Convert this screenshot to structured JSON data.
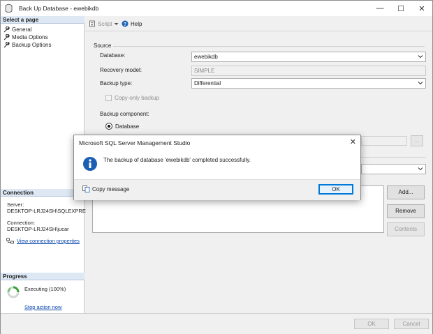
{
  "window": {
    "title": "Back Up Database - ewebikdb",
    "controls": {
      "minimize": "—",
      "maximize": "☐",
      "close": "✕"
    }
  },
  "left_panel": {
    "select_page_header": "Select a page",
    "pages": [
      {
        "label": "General"
      },
      {
        "label": "Media Options"
      },
      {
        "label": "Backup Options"
      }
    ],
    "connection_header": "Connection",
    "server_label": "Server:",
    "server_value": "DESKTOP-LRJ24SH\\SQLEXPRE",
    "connection_label": "Connection:",
    "connection_value": "DESKTOP-LRJ24SH\\jucar",
    "view_connection_link": "View connection properties",
    "progress_header": "Progress",
    "progress_status": "Executing (100%)",
    "stop_action_link": "Stop action now"
  },
  "toolbar": {
    "script_label": "Script",
    "help_label": "Help"
  },
  "form": {
    "source_group": "Source",
    "database_label": "Database:",
    "database_value": "ewebikdb",
    "recovery_model_label": "Recovery model:",
    "recovery_model_value": "SIMPLE",
    "backup_type_label": "Backup type:",
    "backup_type_value": "Differential",
    "copy_only_label": "Copy-only backup",
    "backup_component_label": "Backup component:",
    "database_radio_label": "Database",
    "browse_button": "...",
    "add_button": "Add...",
    "remove_button": "Remove",
    "contents_button": "Contents"
  },
  "footer": {
    "ok_button": "OK",
    "cancel_button": "Cancel"
  },
  "dialog": {
    "title": "Microsoft SQL Server Management Studio",
    "message": "The backup of database 'ewebikdb' completed successfully.",
    "copy_message": "Copy message",
    "ok_button": "OK",
    "close": "✕"
  },
  "colors": {
    "accent": "#0078d7",
    "info_icon": "#1a5fb4",
    "link": "#0645ad",
    "section_header_bg": "#dde8f4"
  },
  "icons": {
    "app": "database-icon",
    "script": "script-icon",
    "help": "help-icon",
    "page": "wrench-icon",
    "connection": "connection-icon",
    "progress": "progress-spinner-icon",
    "info": "info-icon",
    "copy": "copy-icon"
  }
}
